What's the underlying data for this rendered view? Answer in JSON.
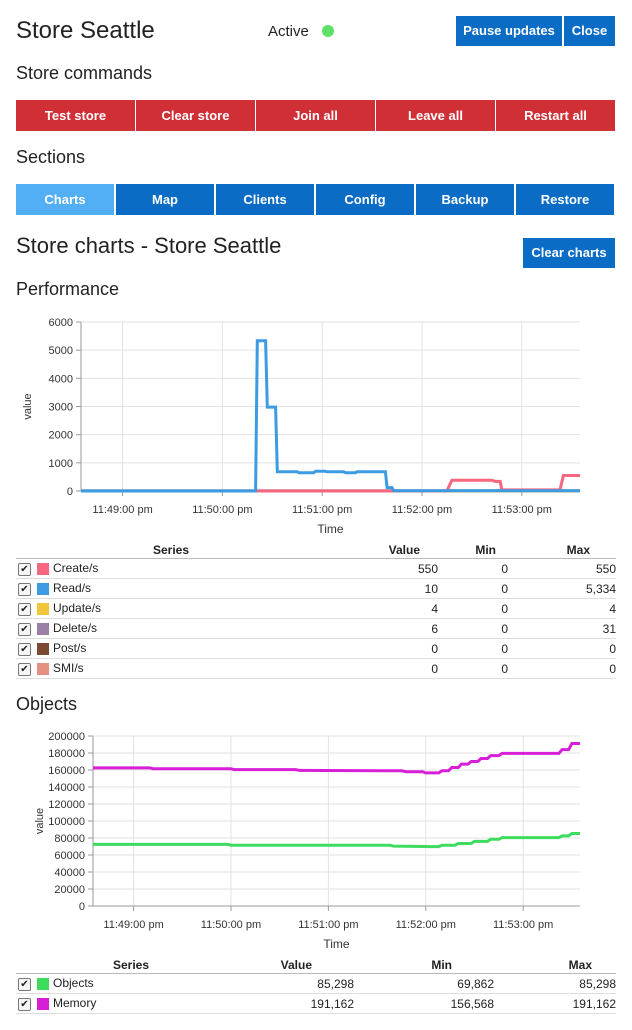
{
  "header": {
    "title": "Store Seattle",
    "status": "Active",
    "status_color": "#5ee06a",
    "pause_label": "Pause updates",
    "close_label": "Close"
  },
  "commands": {
    "heading": "Store commands",
    "buttons": [
      "Test store",
      "Clear store",
      "Join all",
      "Leave all",
      "Restart all"
    ]
  },
  "sections": {
    "heading": "Sections",
    "tabs": [
      "Charts",
      "Map",
      "Clients",
      "Config",
      "Backup",
      "Restore"
    ],
    "active": "Charts"
  },
  "charts_header": {
    "title": "Store charts - Store Seattle",
    "clear_label": "Clear charts"
  },
  "performance": {
    "heading": "Performance",
    "table": {
      "headers": [
        "Series",
        "Value",
        "Min",
        "Max"
      ],
      "rows": [
        {
          "name": "Create/s",
          "color": "#f7677f",
          "value": "550",
          "min": "0",
          "max": "550"
        },
        {
          "name": "Read/s",
          "color": "#3b9be3",
          "value": "10",
          "min": "0",
          "max": "5,334"
        },
        {
          "name": "Update/s",
          "color": "#f2c63a",
          "value": "4",
          "min": "0",
          "max": "4"
        },
        {
          "name": "Delete/s",
          "color": "#9c7fa6",
          "value": "6",
          "min": "0",
          "max": "31"
        },
        {
          "name": "Post/s",
          "color": "#7a4a32",
          "value": "0",
          "min": "0",
          "max": "0"
        },
        {
          "name": "SMI/s",
          "color": "#e59182",
          "value": "0",
          "min": "0",
          "max": "0"
        }
      ]
    }
  },
  "objects": {
    "heading": "Objects",
    "table": {
      "headers": [
        "Series",
        "Value",
        "Min",
        "Max"
      ],
      "rows": [
        {
          "name": "Objects",
          "color": "#3ddc5e",
          "value": "85,298",
          "min": "69,862",
          "max": "85,298"
        },
        {
          "name": "Memory",
          "color": "#d81fd8",
          "value": "191,162",
          "min": "156,568",
          "max": "191,162"
        }
      ]
    }
  },
  "chart_data": [
    {
      "type": "line",
      "xlabel": "Time",
      "ylabel": "value",
      "ylim": [
        0,
        6000
      ],
      "yticks": [
        0,
        1000,
        2000,
        3000,
        4000,
        5000,
        6000
      ],
      "xlim": [
        "11:48:35 pm",
        "11:53:35 pm"
      ],
      "xticks": [
        "11:49:00 pm",
        "11:50:00 pm",
        "11:51:00 pm",
        "11:52:00 pm",
        "11:53:00 pm"
      ],
      "grid": true,
      "series": [
        {
          "name": "Read/s",
          "color": "#3b9be3",
          "points": [
            [
              "11:48:35 pm",
              0
            ],
            [
              "11:50:20 pm",
              0
            ],
            [
              "11:50:21 pm",
              5334
            ],
            [
              "11:50:26 pm",
              5334
            ],
            [
              "11:50:27 pm",
              2980
            ],
            [
              "11:50:32 pm",
              2980
            ],
            [
              "11:50:33 pm",
              680
            ],
            [
              "11:50:45 pm",
              680
            ],
            [
              "11:50:46 pm",
              650
            ],
            [
              "11:50:55 pm",
              650
            ],
            [
              "11:50:56 pm",
              700
            ],
            [
              "11:51:02 pm",
              700
            ],
            [
              "11:51:03 pm",
              680
            ],
            [
              "11:51:13 pm",
              680
            ],
            [
              "11:51:14 pm",
              650
            ],
            [
              "11:51:20 pm",
              650
            ],
            [
              "11:51:21 pm",
              680
            ],
            [
              "11:51:38 pm",
              680
            ],
            [
              "11:51:39 pm",
              120
            ],
            [
              "11:51:42 pm",
              120
            ],
            [
              "11:51:43 pm",
              10
            ],
            [
              "11:53:35 pm",
              10
            ]
          ]
        },
        {
          "name": "Create/s",
          "color": "#f7677f",
          "points": [
            [
              "11:48:35 pm",
              0
            ],
            [
              "11:52:15 pm",
              0
            ],
            [
              "11:52:18 pm",
              380
            ],
            [
              "11:52:42 pm",
              380
            ],
            [
              "11:52:44 pm",
              340
            ],
            [
              "11:52:47 pm",
              340
            ],
            [
              "11:52:48 pm",
              40
            ],
            [
              "11:53:23 pm",
              40
            ],
            [
              "11:53:25 pm",
              550
            ],
            [
              "11:53:35 pm",
              550
            ]
          ]
        },
        {
          "name": "Update/s",
          "color": "#f2c63a",
          "points": [
            [
              "11:48:35 pm",
              0
            ],
            [
              "11:53:35 pm",
              4
            ]
          ]
        },
        {
          "name": "Delete/s",
          "color": "#9c7fa6",
          "points": [
            [
              "11:48:35 pm",
              6
            ],
            [
              "11:53:35 pm",
              6
            ]
          ]
        },
        {
          "name": "Post/s",
          "color": "#7a4a32",
          "points": [
            [
              "11:48:35 pm",
              0
            ],
            [
              "11:53:35 pm",
              0
            ]
          ]
        },
        {
          "name": "SMI/s",
          "color": "#e59182",
          "points": [
            [
              "11:48:35 pm",
              0
            ],
            [
              "11:53:35 pm",
              0
            ]
          ]
        }
      ]
    },
    {
      "type": "line",
      "xlabel": "Time",
      "ylabel": "value",
      "ylim": [
        0,
        200000
      ],
      "yticks": [
        0,
        20000,
        40000,
        60000,
        80000,
        100000,
        120000,
        140000,
        160000,
        180000,
        200000
      ],
      "xlim": [
        "11:48:35 pm",
        "11:53:35 pm"
      ],
      "xticks": [
        "11:49:00 pm",
        "11:50:00 pm",
        "11:51:00 pm",
        "11:52:00 pm",
        "11:53:00 pm"
      ],
      "grid": true,
      "series": [
        {
          "name": "Memory",
          "color": "#d81fd8",
          "points": [
            [
              "11:48:35 pm",
              162500
            ],
            [
              "11:49:10 pm",
              162500
            ],
            [
              "11:49:12 pm",
              161500
            ],
            [
              "11:50:00 pm",
              161500
            ],
            [
              "11:50:02 pm",
              160500
            ],
            [
              "11:50:40 pm",
              160500
            ],
            [
              "11:50:42 pm",
              159500
            ],
            [
              "11:51:45 pm",
              159000
            ],
            [
              "11:51:48 pm",
              158000
            ],
            [
              "11:51:58 pm",
              158000
            ],
            [
              "11:52:00 pm",
              156568
            ],
            [
              "11:52:08 pm",
              156568
            ],
            [
              "11:52:10 pm",
              159000
            ],
            [
              "11:52:14 pm",
              159000
            ],
            [
              "11:52:16 pm",
              163000
            ],
            [
              "11:52:20 pm",
              163000
            ],
            [
              "11:52:22 pm",
              167000
            ],
            [
              "11:52:26 pm",
              167000
            ],
            [
              "11:52:28 pm",
              170000
            ],
            [
              "11:52:32 pm",
              170000
            ],
            [
              "11:52:34 pm",
              173500
            ],
            [
              "11:52:38 pm",
              173500
            ],
            [
              "11:52:40 pm",
              177000
            ],
            [
              "11:52:45 pm",
              177000
            ],
            [
              "11:52:47 pm",
              179500
            ],
            [
              "11:53:22 pm",
              179500
            ],
            [
              "11:53:24 pm",
              184000
            ],
            [
              "11:53:28 pm",
              184000
            ],
            [
              "11:53:30 pm",
              191162
            ],
            [
              "11:53:35 pm",
              191162
            ]
          ]
        },
        {
          "name": "Objects",
          "color": "#3ddc5e",
          "points": [
            [
              "11:48:35 pm",
              72500
            ],
            [
              "11:49:58 pm",
              72500
            ],
            [
              "11:50:00 pm",
              71500
            ],
            [
              "11:51:38 pm",
              71500
            ],
            [
              "11:51:40 pm",
              70500
            ],
            [
              "11:52:00 pm",
              70000
            ],
            [
              "11:52:02 pm",
              69862
            ],
            [
              "11:52:08 pm",
              69862
            ],
            [
              "11:52:10 pm",
              71500
            ],
            [
              "11:52:18 pm",
              71500
            ],
            [
              "11:52:20 pm",
              73500
            ],
            [
              "11:52:28 pm",
              73500
            ],
            [
              "11:52:30 pm",
              76000
            ],
            [
              "11:52:38 pm",
              76000
            ],
            [
              "11:52:40 pm",
              78500
            ],
            [
              "11:52:45 pm",
              78500
            ],
            [
              "11:52:47 pm",
              80500
            ],
            [
              "11:53:22 pm",
              80500
            ],
            [
              "11:53:24 pm",
              82500
            ],
            [
              "11:53:28 pm",
              82500
            ],
            [
              "11:53:30 pm",
              85298
            ],
            [
              "11:53:35 pm",
              85298
            ]
          ]
        }
      ]
    }
  ]
}
